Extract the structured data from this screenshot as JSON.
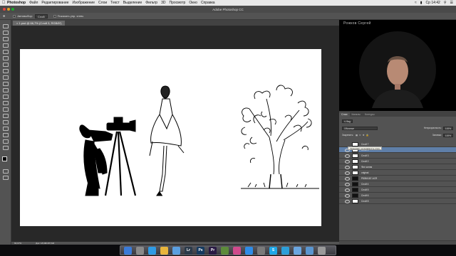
{
  "menubar": {
    "app": "Photoshop",
    "items": [
      "Файл",
      "Редактирование",
      "Изображение",
      "Слои",
      "Текст",
      "Выделение",
      "Фильтр",
      "3D",
      "Просмотр",
      "Окно",
      "Справка"
    ],
    "clock": "Ср 14:42"
  },
  "window": {
    "title": "Adobe Photoshop CC"
  },
  "options": {
    "autoselect_label": "Автовыбор:",
    "autoselect_value": "Слой",
    "transform_label": "Показать упр. элем."
  },
  "document": {
    "tab": "1.psd @ 66,7% (Слой 3, RGB/8*)",
    "zoom": "66,67%",
    "doc_info": "Док: 18,9M/187,6M"
  },
  "webcam": {
    "name": "Рожков Сергей"
  },
  "panel": {
    "tabs": [
      "Слои",
      "Каналы",
      "Контуры"
    ],
    "kind_label": "Вид",
    "blend_mode": "Обычные",
    "opacity_label": "Непрозрачность:",
    "opacity_value": "100%",
    "lock_label": "Закрепить:",
    "fill_label": "Заливка:",
    "fill_value": "100%",
    "tooltip": "Указывает на видимость слоя",
    "layers": [
      {
        "name": "Слой 7",
        "selected": false,
        "thumb": "light",
        "vis": false
      },
      {
        "name": "Слой 1",
        "selected": true,
        "thumb": "light",
        "vis": true
      },
      {
        "name": "Слой 3",
        "selected": false,
        "thumb": "light",
        "vis": true
      },
      {
        "name": "Слой 2",
        "selected": false,
        "thumb": "light",
        "vis": true
      },
      {
        "name": "Фон копия",
        "selected": false,
        "thumb": "light",
        "vis": true
      },
      {
        "name": "original",
        "selected": false,
        "thumb": "light",
        "vis": true
      },
      {
        "name": "P8084187-ACR",
        "selected": false,
        "thumb": "dark",
        "vis": true
      },
      {
        "name": "Слой 4",
        "selected": false,
        "thumb": "dark",
        "vis": true
      },
      {
        "name": "Слой 5",
        "selected": false,
        "thumb": "dark",
        "vis": true
      },
      {
        "name": "Слой 6",
        "selected": false,
        "thumb": "dark",
        "vis": true
      },
      {
        "name": "Слой 8",
        "selected": false,
        "thumb": "light",
        "vis": true
      }
    ]
  },
  "dock": {
    "icons": [
      {
        "name": "finder-icon",
        "label": "",
        "color": "#3b7bd8"
      },
      {
        "name": "launchpad-icon",
        "label": "",
        "color": "#8a8a8a"
      },
      {
        "name": "safari-icon",
        "label": "",
        "color": "#2f9be5"
      },
      {
        "name": "chrome-icon",
        "label": "",
        "color": "#e8b53c"
      },
      {
        "name": "mail-icon",
        "label": "",
        "color": "#5a9fe0"
      },
      {
        "name": "lightroom-icon",
        "label": "Lr",
        "color": "#2b3a4a"
      },
      {
        "name": "photoshop-icon",
        "label": "Ps",
        "color": "#163a5f"
      },
      {
        "name": "premiere-icon",
        "label": "Pr",
        "color": "#2a1a44"
      },
      {
        "name": "dreamweaver-icon",
        "label": "",
        "color": "#5d8b3b"
      },
      {
        "name": "itunes-icon",
        "label": "",
        "color": "#d04a8c"
      },
      {
        "name": "app-store-icon",
        "label": "",
        "color": "#2e8ce8"
      },
      {
        "name": "system-preferences-icon",
        "label": "",
        "color": "#7a7a7a"
      },
      {
        "name": "skype-icon",
        "label": "S",
        "color": "#1fa8e8"
      },
      {
        "name": "telegram-icon",
        "label": "",
        "color": "#2c9ed8"
      },
      {
        "name": "downloads-folder-icon",
        "label": "",
        "color": "#6aa6e0"
      },
      {
        "name": "documents-folder-icon",
        "label": "",
        "color": "#5a96d0"
      },
      {
        "name": "trash-icon",
        "label": "",
        "color": "#9a9a9a"
      }
    ]
  }
}
